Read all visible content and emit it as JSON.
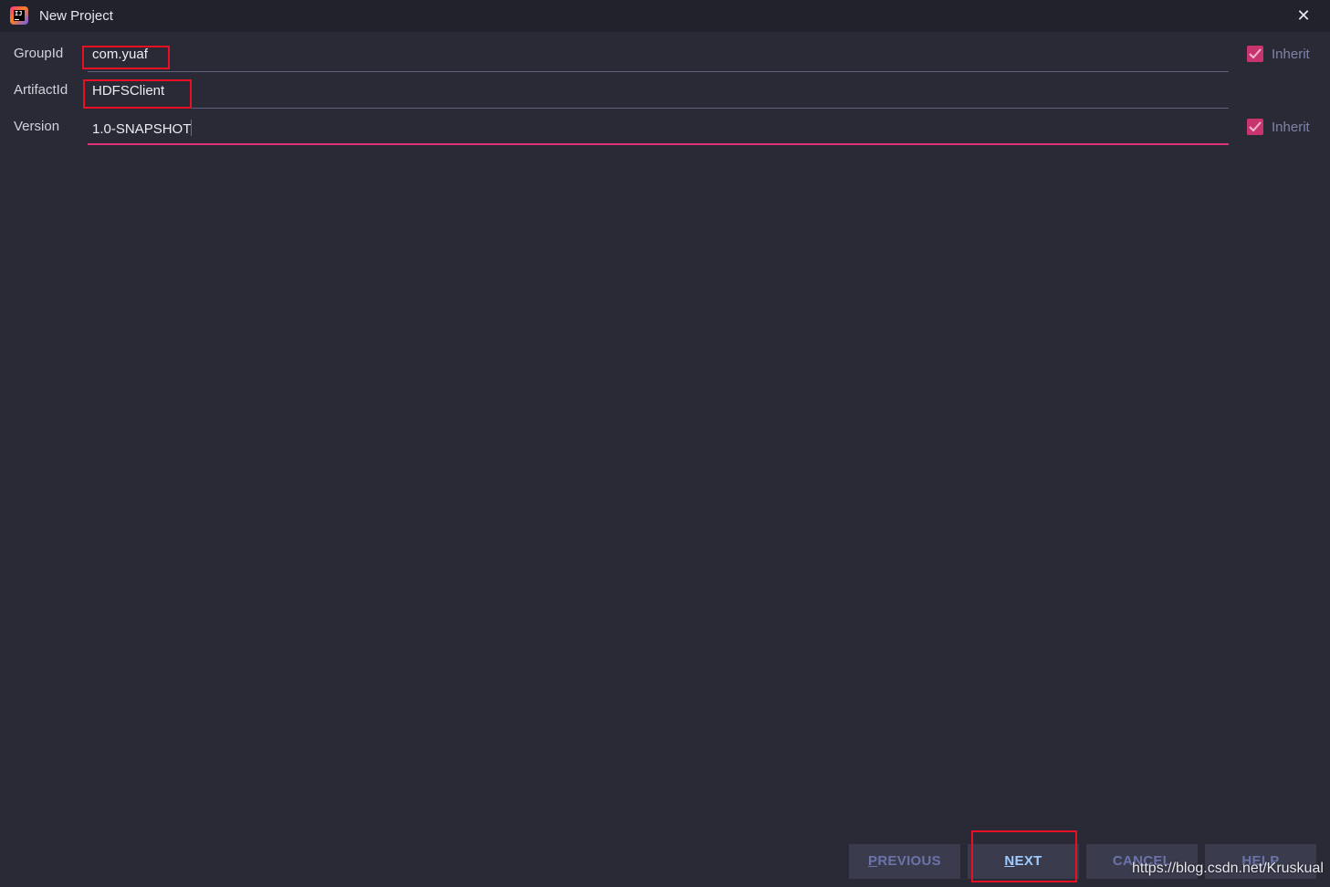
{
  "window": {
    "title": "New Project",
    "app_icon_text": "IJ"
  },
  "form": {
    "group_id": {
      "label": "GroupId",
      "value": "com.yuaf",
      "inherit_label": "Inherit",
      "inherit_checked": true
    },
    "artifact_id": {
      "label": "ArtifactId",
      "value": "HDFSClient"
    },
    "version": {
      "label": "Version",
      "value": "1.0-SNAPSHOT",
      "inherit_label": "Inherit",
      "inherit_checked": true
    }
  },
  "buttons": {
    "previous": {
      "mnemonic": "P",
      "rest": "REVIOUS"
    },
    "next": {
      "mnemonic": "N",
      "rest": "EXT"
    },
    "cancel": {
      "label": "CANCEL"
    },
    "help": {
      "label": "HELP"
    }
  },
  "watermark": "https://blog.csdn.net/Kruskual",
  "colors": {
    "background": "#292a35",
    "titlebar": "#21222c",
    "accent": "#e0307a",
    "checkbox": "#c8356e",
    "annotation_red": "#e81123"
  }
}
